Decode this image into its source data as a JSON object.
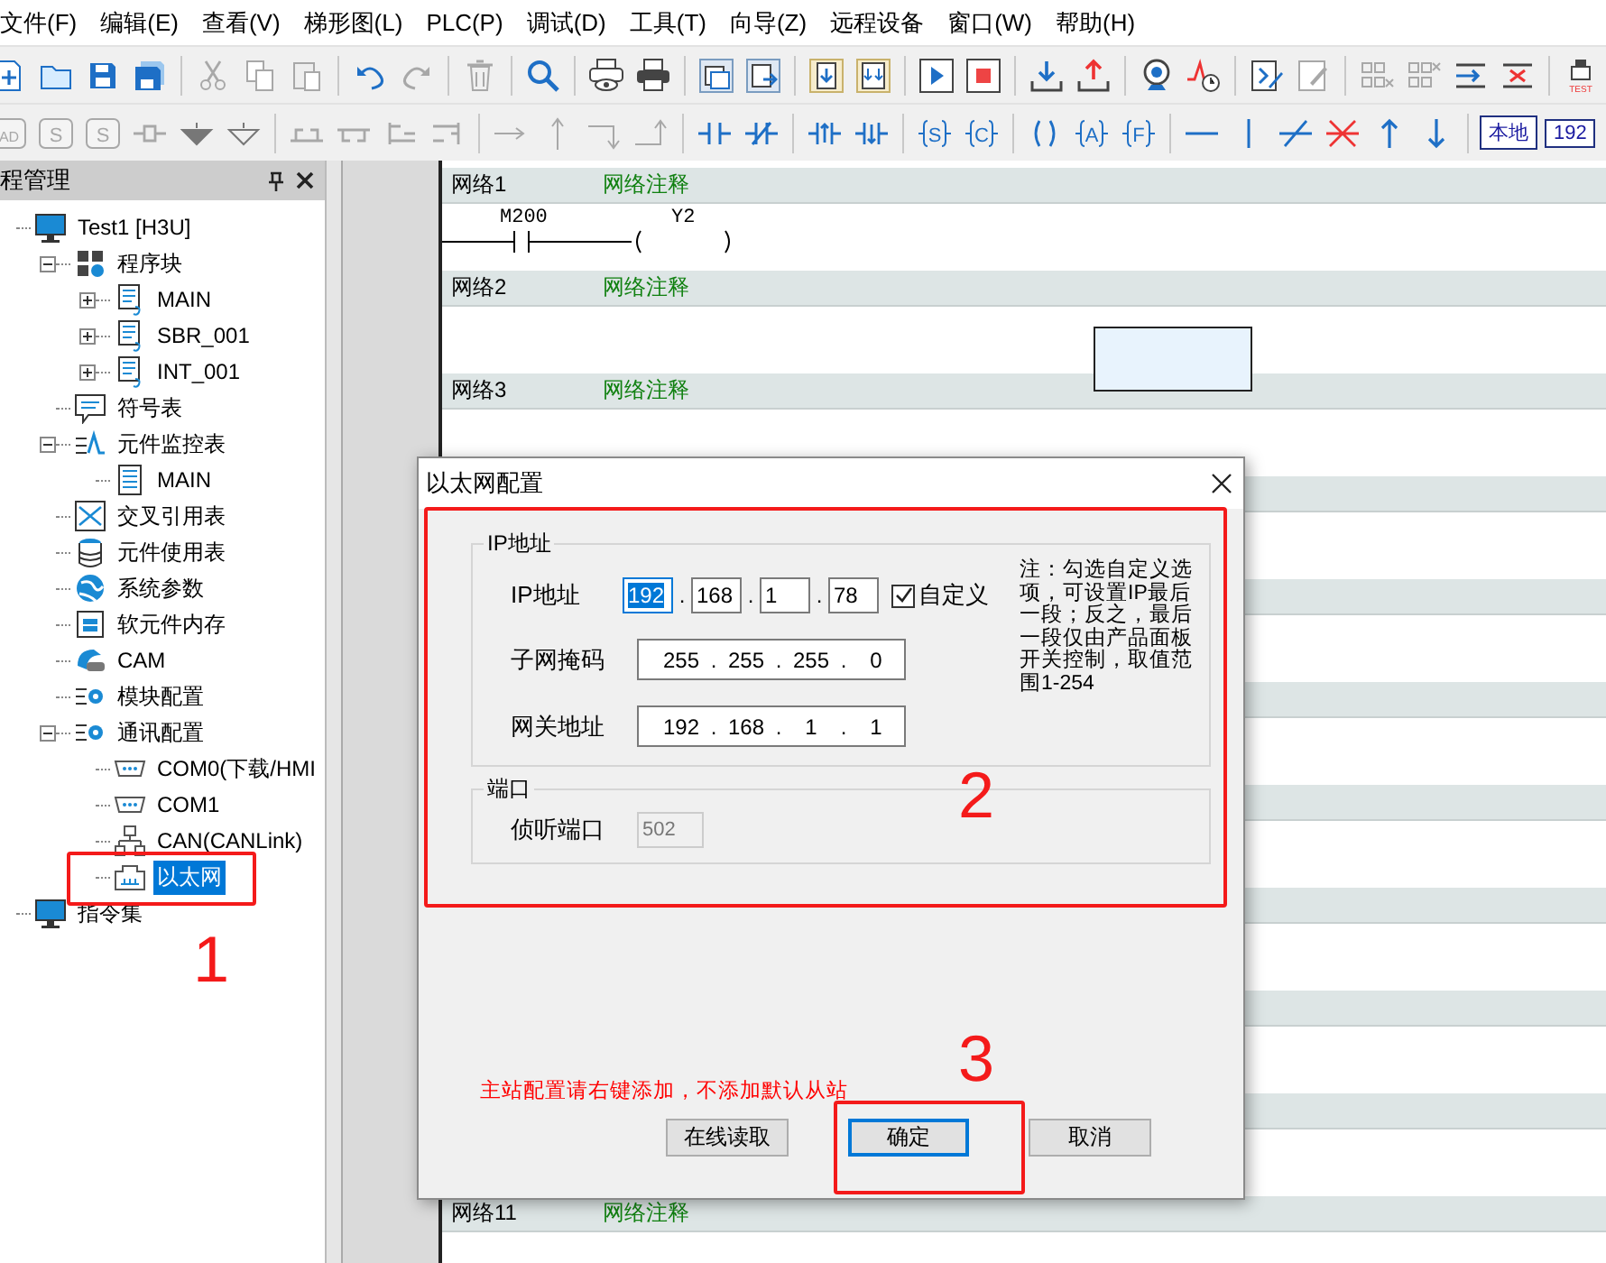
{
  "menu": [
    "文件(F)",
    "编辑(E)",
    "查看(V)",
    "梯形图(L)",
    "PLC(P)",
    "调试(D)",
    "工具(T)",
    "向导(Z)",
    "远程设备",
    "窗口(W)",
    "帮助(H)"
  ],
  "toolbar_1_letters": [
    "TEST"
  ],
  "toolbar_2_letters": [
    "AD",
    "S",
    "S",
    "S",
    "C",
    "A",
    "F"
  ],
  "toolbar_2_fields": [
    "本地",
    "192"
  ],
  "panel": {
    "title": "程管理"
  },
  "tree": [
    {
      "label": "Test1  [H3U]",
      "kind": "project",
      "selected": false,
      "children": [
        {
          "label": "程序块",
          "kind": "blocks",
          "expanded": true,
          "selected": false,
          "children": [
            {
              "label": "MAIN",
              "kind": "program",
              "expanded": false,
              "selected": false
            },
            {
              "label": "SBR_001",
              "kind": "program",
              "expanded": false,
              "selected": false
            },
            {
              "label": "INT_001",
              "kind": "program",
              "expanded": false,
              "selected": false
            }
          ]
        },
        {
          "label": "符号表",
          "kind": "symbols",
          "selected": false
        },
        {
          "label": "元件监控表",
          "kind": "monitor",
          "expanded": true,
          "selected": false,
          "children": [
            {
              "label": "MAIN",
              "kind": "table",
              "selected": false
            }
          ]
        },
        {
          "label": "交叉引用表",
          "kind": "crossref",
          "selected": false
        },
        {
          "label": "元件使用表",
          "kind": "usage",
          "selected": false
        },
        {
          "label": "系统参数",
          "kind": "params",
          "selected": false
        },
        {
          "label": "软元件内存",
          "kind": "memory",
          "selected": false
        },
        {
          "label": "CAM",
          "kind": "cam",
          "selected": false
        },
        {
          "label": "模块配置",
          "kind": "modules",
          "selected": false
        },
        {
          "label": "通讯配置",
          "kind": "comms",
          "expanded": true,
          "selected": false,
          "children": [
            {
              "label": "COM0(下载/HMI",
              "kind": "serial",
              "selected": false
            },
            {
              "label": "COM1",
              "kind": "serial",
              "selected": false
            },
            {
              "label": "CAN(CANLink)",
              "kind": "can",
              "selected": false
            },
            {
              "label": "以太网",
              "kind": "ethernet",
              "selected": true
            }
          ]
        }
      ]
    },
    {
      "label": "指令集",
      "kind": "project",
      "selected": false
    }
  ],
  "networks": [
    {
      "label": "网络1",
      "comment": "网络注释",
      "kind": "rung",
      "contact": "M200",
      "coil": "Y2"
    },
    {
      "label": "网络2",
      "comment": "网络注释",
      "kind": "cursor"
    },
    {
      "label": "网络3",
      "comment": "网络注释",
      "kind": "empty"
    }
  ],
  "last_network": {
    "label": "网络11",
    "comment": "网络注释"
  },
  "dialog": {
    "title": "以太网配置",
    "octet_separator": ".",
    "ip_group": {
      "title": "IP地址",
      "ip_label": "IP地址",
      "ip": [
        "192",
        "168",
        "1",
        "78"
      ],
      "custom": {
        "label": "自定义",
        "checked": true
      },
      "note": "注：勾选自定义选项，可设置IP最后一段；反之，最后一段仅由产品面板开关控制，取值范围1-254",
      "mask_label": "子网掩码",
      "mask": [
        "255",
        "255",
        "255",
        "0"
      ],
      "gateway_label": "网关地址",
      "gateway": [
        "192",
        "168",
        "1",
        "1"
      ]
    },
    "port_group": {
      "title": "端口",
      "label": "侦听端口",
      "value": "502",
      "disabled": true
    },
    "message": "主站配置请右键添加，不添加默认从站",
    "buttons": [
      {
        "label": "在线读取",
        "focused": false
      },
      {
        "label": "确定",
        "focused": true
      },
      {
        "label": "取消",
        "focused": false
      }
    ]
  },
  "annotations": [
    "1",
    "2",
    "3"
  ]
}
